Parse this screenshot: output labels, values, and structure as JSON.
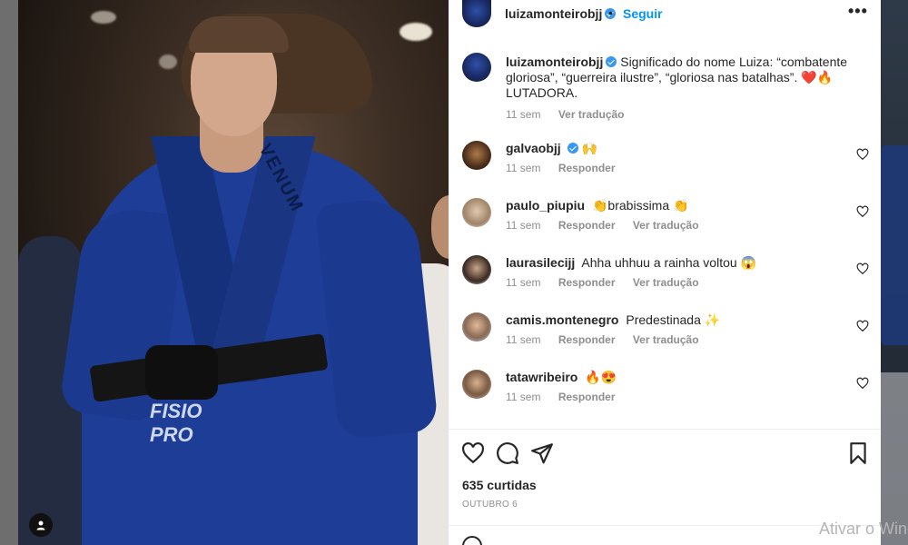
{
  "post": {
    "author": "luizamonteirobjj",
    "follow_label": "Seguir",
    "dot": "•",
    "more_label": "•••"
  },
  "caption": {
    "username": "luizamonteirobjj",
    "text": "Significado do nome Luiza: “combatente gloriosa”, “guerreira ilustre”, “gloriosa nas batalhas”. ❤️🔥 LUTADORA.",
    "time": "11 sem",
    "translate_label": "Ver tradução"
  },
  "comments": [
    {
      "username": "galvaobjj",
      "verified": true,
      "text": "🙌",
      "time": "11 sem",
      "reply_label": "Responder",
      "translate_label": ""
    },
    {
      "username": "paulo_piupiu",
      "verified": false,
      "text": "👏brabissima 👏",
      "time": "11 sem",
      "reply_label": "Responder",
      "translate_label": "Ver tradução"
    },
    {
      "username": "laurasilecijj",
      "verified": false,
      "text": "Ahha uhhuu a rainha voltou 😱",
      "time": "11 sem",
      "reply_label": "Responder",
      "translate_label": "Ver tradução"
    },
    {
      "username": "camis.montenegro",
      "verified": false,
      "text": "Predestinada ✨",
      "time": "11 sem",
      "reply_label": "Responder",
      "translate_label": "Ver tradução"
    },
    {
      "username": "tatawribeiro",
      "verified": false,
      "text": "🔥😍",
      "time": "11 sem",
      "reply_label": "Responder",
      "translate_label": ""
    }
  ],
  "stats": {
    "likes": "635 curtidas",
    "date": "OUTUBRO 6"
  },
  "photo": {
    "patch_text": "FISIO PRO",
    "gi_brand": "VENUM"
  },
  "watermark": "Ativar o Windows",
  "colors": {
    "accent": "#0095f6",
    "verified": "#3897f0",
    "muted": "#8e8e8e",
    "gi_blue": "#1d3d96"
  },
  "icons": [
    "heart-icon",
    "comment-icon",
    "share-icon",
    "bookmark-icon",
    "more-icon",
    "verified-icon",
    "user-icon"
  ]
}
